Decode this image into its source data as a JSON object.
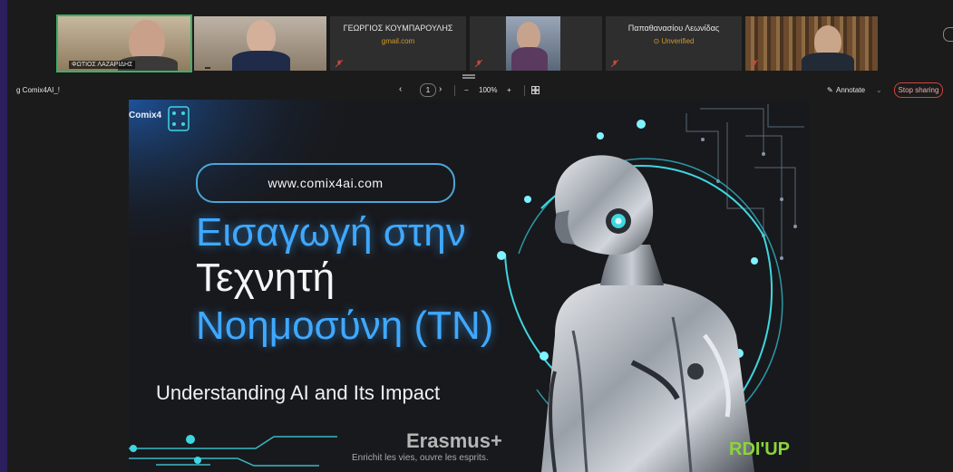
{
  "participants": [
    {
      "id": "p1",
      "name": "ΦΩΤΙΟΣ ΛΑΖΑΡΙΔΗΣ",
      "type": "video",
      "active": true
    },
    {
      "id": "p2",
      "name": "",
      "type": "video",
      "active": false
    },
    {
      "id": "p3",
      "name": "ΓΕΩΡΓΙΟΣ ΚΟΥΜΠΑΡΟΥΛΗΣ",
      "subtitle": "gmail.com",
      "type": "name",
      "active": false
    },
    {
      "id": "p4",
      "name": "",
      "type": "video",
      "active": false
    },
    {
      "id": "p5",
      "name": "Παπαθανασίου Λεωνίδας",
      "subtitle": "Unverified",
      "type": "name",
      "active": false
    },
    {
      "id": "p6",
      "name": "",
      "type": "video",
      "active": false
    }
  ],
  "toolbar": {
    "document_name": "g Comix4AI_!",
    "page": "1",
    "zoom_minus": "−",
    "zoom": "100%",
    "zoom_plus": "+",
    "annotate": "Annotate",
    "stop_sharing": "Stop sharing"
  },
  "slide": {
    "logo": "Comix4",
    "url": "www.comix4ai.com",
    "title_line1": "Εισαγωγή στην",
    "title_line2": "Τεχνητή",
    "title_line3": "Νοημοσύνη (ΤΝ)",
    "subtitle": "Understanding AI and Its Impact",
    "partner_erasmus": "Erasmus+",
    "partner_erasmus_tagline": "Enrichit les vies, ouvre les esprits.",
    "partner_rdi": "RDI'UP"
  },
  "colors": {
    "accent_blue": "#3fa8ff",
    "stop_red": "#d0453c",
    "rdi_green": "#8cd43a",
    "cyan": "#3fd6e0"
  }
}
